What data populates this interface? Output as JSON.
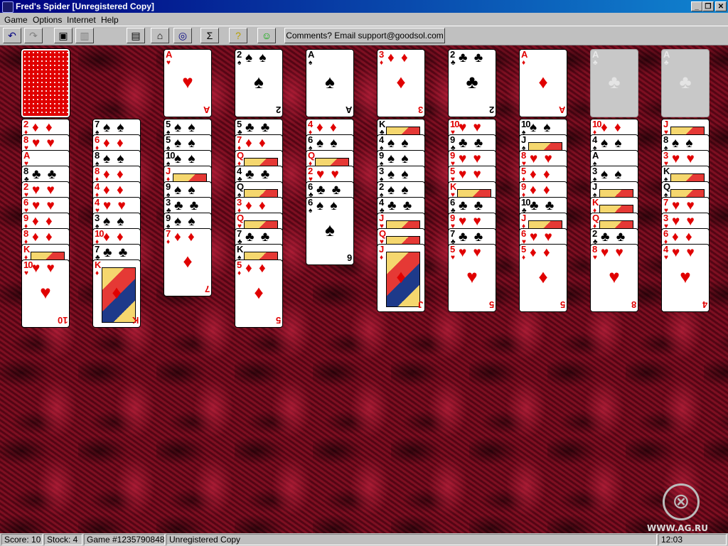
{
  "window": {
    "title": "Fred's Spider [Unregistered Copy]",
    "minimize": "_",
    "maximize": "❐",
    "close": "✕"
  },
  "menu": [
    "Game",
    "Options",
    "Internet",
    "Help"
  ],
  "toolbar": {
    "buttons": [
      "undo-icon",
      "redo-icon",
      "camera-icon",
      "disabled-icon",
      "bin-icon",
      "home-icon",
      "search-globe-icon",
      "sigma-icon",
      "hint-icon",
      "smiley-icon"
    ],
    "glyphs": {
      "undo-icon": "↶",
      "redo-icon": "↷",
      "camera-icon": "▣",
      "disabled-icon": "▥",
      "bin-icon": "▤",
      "home-icon": "⌂",
      "search-globe-icon": "◎",
      "sigma-icon": "Σ",
      "hint-icon": "?",
      "smiley-icon": "☺"
    },
    "comments_label": "Comments? Email support@goodsol.com"
  },
  "game": {
    "stock_card": "face-down",
    "foundations": [
      {
        "rank": "A",
        "suit": "♥",
        "color": "red"
      },
      {
        "rank": "2",
        "suit": "♠",
        "color": "black"
      },
      {
        "rank": "A",
        "suit": "♠",
        "color": "black"
      },
      {
        "rank": "3",
        "suit": "♦",
        "color": "red"
      },
      {
        "rank": "2",
        "suit": "♣",
        "color": "black"
      },
      {
        "rank": "A",
        "suit": "♦",
        "color": "red"
      },
      {
        "rank": "A",
        "suit": "♣",
        "color": "empty"
      },
      {
        "rank": "A",
        "suit": "♣",
        "color": "empty"
      }
    ],
    "tableau": [
      [
        [
          "2",
          "♦"
        ],
        [
          "8",
          "♥"
        ],
        [
          "A",
          "♥"
        ],
        [
          "8",
          "♣"
        ],
        [
          "2",
          "♥"
        ],
        [
          "6",
          "♥"
        ],
        [
          "9",
          "♦"
        ],
        [
          "8",
          "♦"
        ],
        [
          "K",
          "♦"
        ],
        [
          "10",
          "♥"
        ]
      ],
      [
        [
          "7",
          "♠"
        ],
        [
          "6",
          "♦"
        ],
        [
          "8",
          "♠"
        ],
        [
          "8",
          "♦"
        ],
        [
          "4",
          "♦"
        ],
        [
          "4",
          "♥"
        ],
        [
          "3",
          "♠"
        ],
        [
          "10",
          "♦"
        ],
        [
          "7",
          "♣"
        ],
        [
          "K",
          "♦"
        ]
      ],
      [
        [
          "5",
          "♠"
        ],
        [
          "5",
          "♠"
        ],
        [
          "10",
          "♠"
        ],
        [
          "J",
          "♦"
        ],
        [
          "9",
          "♠"
        ],
        [
          "3",
          "♣"
        ],
        [
          "9",
          "♠"
        ],
        [
          "7",
          "♦"
        ]
      ],
      [
        [
          "5",
          "♣"
        ],
        [
          "7",
          "♦"
        ],
        [
          "Q",
          "♦"
        ],
        [
          "4",
          "♣"
        ],
        [
          "Q",
          "♠"
        ],
        [
          "3",
          "♦"
        ],
        [
          "Q",
          "♥"
        ],
        [
          "7",
          "♣"
        ],
        [
          "K",
          "♠"
        ],
        [
          "5",
          "♦"
        ]
      ],
      [
        [
          "4",
          "♦"
        ],
        [
          "6",
          "♠"
        ],
        [
          "Q",
          "♦"
        ],
        [
          "2",
          "♥"
        ],
        [
          "6",
          "♣"
        ],
        [
          "6",
          "♠"
        ]
      ],
      [
        [
          "K",
          "♣"
        ],
        [
          "4",
          "♠"
        ],
        [
          "9",
          "♠"
        ],
        [
          "3",
          "♠"
        ],
        [
          "2",
          "♠"
        ],
        [
          "4",
          "♣"
        ],
        [
          "J",
          "♥"
        ],
        [
          "Q",
          "♥"
        ],
        [
          "J",
          "♦"
        ]
      ],
      [
        [
          "10",
          "♥"
        ],
        [
          "9",
          "♣"
        ],
        [
          "9",
          "♥"
        ],
        [
          "5",
          "♥"
        ],
        [
          "K",
          "♥"
        ],
        [
          "6",
          "♣"
        ],
        [
          "9",
          "♥"
        ],
        [
          "7",
          "♣"
        ],
        [
          "5",
          "♥"
        ]
      ],
      [
        [
          "10",
          "♠"
        ],
        [
          "J",
          "♠"
        ],
        [
          "8",
          "♥"
        ],
        [
          "5",
          "♦"
        ],
        [
          "9",
          "♦"
        ],
        [
          "10",
          "♣"
        ],
        [
          "J",
          "♦"
        ],
        [
          "6",
          "♥"
        ],
        [
          "5",
          "♦"
        ]
      ],
      [
        [
          "10",
          "♦"
        ],
        [
          "4",
          "♠"
        ],
        [
          "A",
          "♠"
        ],
        [
          "3",
          "♠"
        ],
        [
          "J",
          "♠"
        ],
        [
          "K",
          "♦"
        ],
        [
          "Q",
          "♦"
        ],
        [
          "2",
          "♣"
        ],
        [
          "8",
          "♥"
        ]
      ],
      [
        [
          "J",
          "♥"
        ],
        [
          "8",
          "♠"
        ],
        [
          "3",
          "♥"
        ],
        [
          "K",
          "♠"
        ],
        [
          "Q",
          "♠"
        ],
        [
          "7",
          "♥"
        ],
        [
          "3",
          "♥"
        ],
        [
          "6",
          "♦"
        ],
        [
          "4",
          "♥"
        ]
      ]
    ]
  },
  "status": {
    "score": "Score:  10",
    "stock": "Stock: 4",
    "game": "Game #1235790848",
    "registration": "Unregistered Copy",
    "time": "12:03"
  },
  "watermark": "WWW.AG.RU"
}
